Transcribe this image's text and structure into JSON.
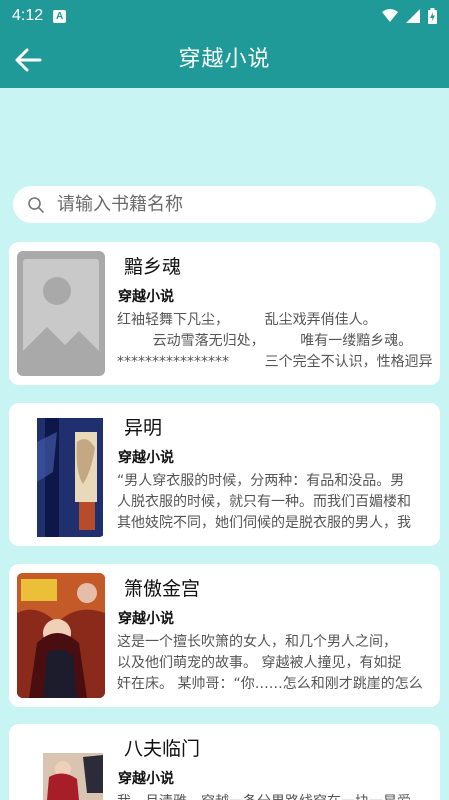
{
  "status": {
    "time": "4:12",
    "app_badge": "A"
  },
  "header": {
    "title": "穿越小说"
  },
  "search": {
    "placeholder": "请输入书籍名称",
    "value": ""
  },
  "books": [
    {
      "title": "黯乡魂",
      "category": "穿越小说",
      "desc_lines": [
        "红袖轻舞下凡尘，        乱尘戏弄俏佳人。",
        "        云动雪落无归处，        唯有一缕黯乡魂。",
        "****************        三个完全不认识，性格迥异"
      ],
      "cover": "placeholder-image-icon"
    },
    {
      "title": "异明",
      "category": "穿越小说",
      "desc_lines": [
        "“男人穿衣服的时候，分两种：有品和没品。男",
        "人脱衣服的时候，就只有一种。而我们百媚楼和",
        "其他妓院不同，她们伺候的是脱衣服的男人，我"
      ],
      "cover": "book-cover"
    },
    {
      "title": "箫傲金宫",
      "category": "穿越小说",
      "desc_lines": [
        "这是一个擅长吹箫的女人，和几个男人之间，",
        "以及他们萌宠的故事。 穿越被人撞见，有如捉",
        "奸在床。 某帅哥：“你……怎么和刚才跳崖的怎么"
      ],
      "cover": "book-cover"
    },
    {
      "title": "八夫临门",
      "category": "穿越小说",
      "desc_lines": [
        "我，月清雅，穿越一条分界路线穿在一块一星爱"
      ],
      "cover": "book-cover"
    }
  ],
  "colors": {
    "primary": "#1f9a98",
    "background": "#c8f4f3"
  }
}
